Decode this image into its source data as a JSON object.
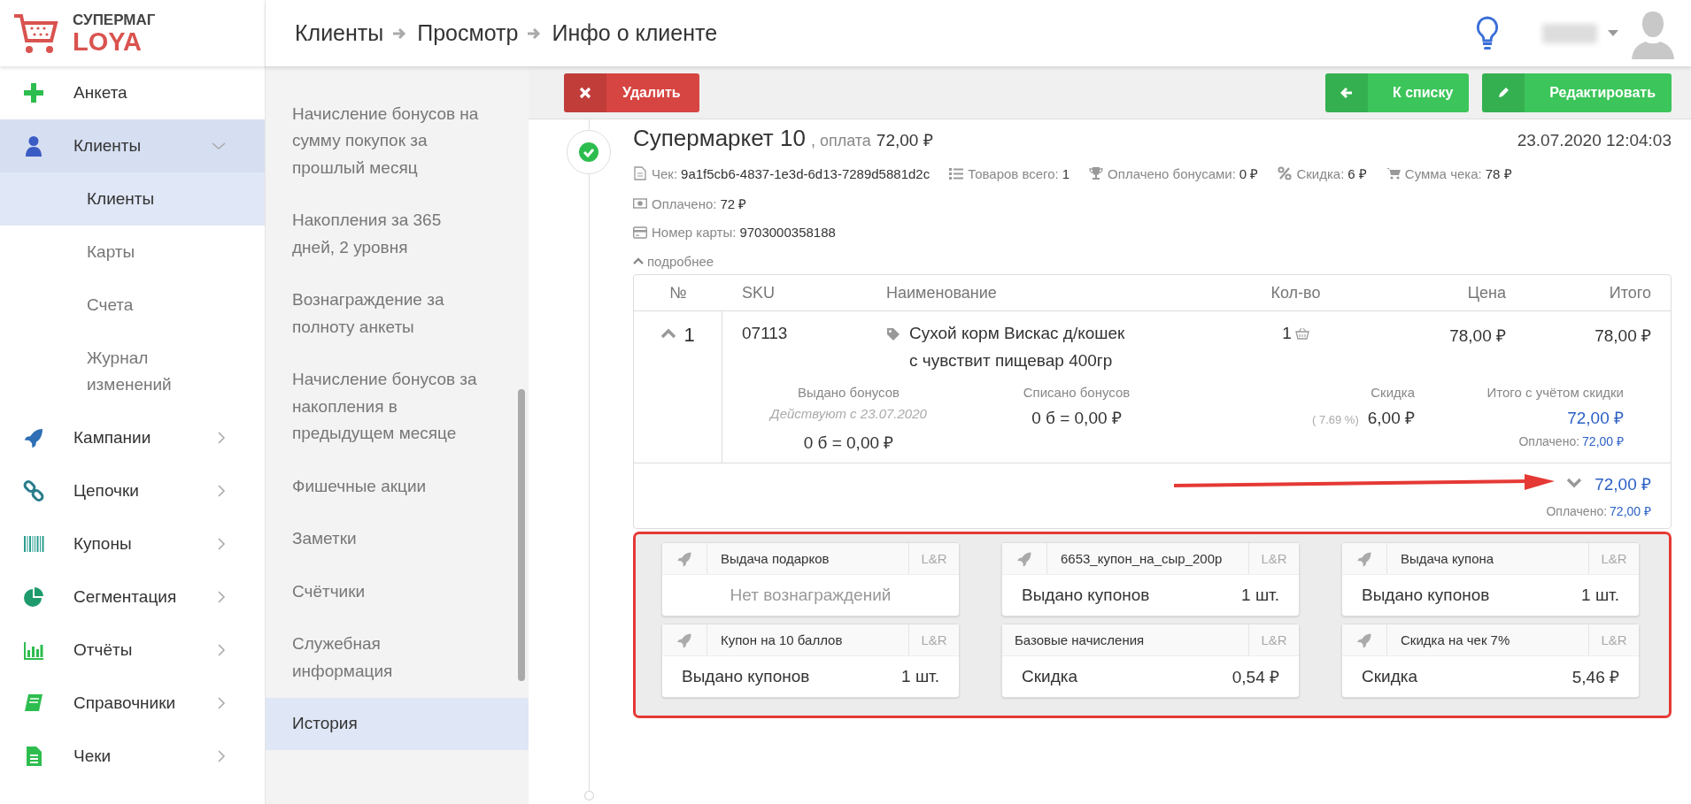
{
  "logo": {
    "top": "СУПЕРМАГ",
    "bottom": "LOYA"
  },
  "breadcrumb": [
    "Клиенты",
    "Просмотр",
    "Инфо о клиенте"
  ],
  "sidebar": {
    "items": [
      {
        "label": "Анкета",
        "selected": false
      },
      {
        "label": "Клиенты",
        "selected": true,
        "expanded": true,
        "children": [
          {
            "label": "Клиенты",
            "selected": true
          },
          {
            "label": "Карты",
            "selected": false
          },
          {
            "label": "Счета",
            "selected": false
          },
          {
            "label": "Журнал изменений",
            "selected": false
          }
        ]
      },
      {
        "label": "Кампании",
        "selected": false,
        "expanded": false
      },
      {
        "label": "Цепочки",
        "selected": false,
        "expanded": false
      },
      {
        "label": "Купоны",
        "selected": false,
        "expanded": false
      },
      {
        "label": "Сегментация",
        "selected": false,
        "expanded": false
      },
      {
        "label": "Отчёты",
        "selected": false,
        "expanded": false
      },
      {
        "label": "Справочники",
        "selected": false,
        "expanded": false
      },
      {
        "label": "Чеки",
        "selected": false,
        "expanded": false
      }
    ]
  },
  "submenu": {
    "items": [
      {
        "label": "Начисление бонусов на сумму покупок за прошлый месяц",
        "selected": false
      },
      {
        "label": "Накопления за 365 дней, 2 уровня",
        "selected": false
      },
      {
        "label": "Вознаграждение за полноту анкеты",
        "selected": false
      },
      {
        "label": "Начисление бонусов за накопления в предыдущем месяце",
        "selected": false
      },
      {
        "label": "Фишечные акции",
        "selected": false
      },
      {
        "label": "Заметки",
        "selected": false
      },
      {
        "label": "Счётчики",
        "selected": false
      },
      {
        "label": "Служебная информация",
        "selected": false
      },
      {
        "label": "История",
        "selected": true
      }
    ]
  },
  "toolbar": {
    "buttons": [
      {
        "label": "Удалить",
        "kind": "delete"
      },
      {
        "label": "К списку",
        "kind": "back"
      },
      {
        "label": "Редактировать",
        "kind": "edit"
      }
    ]
  },
  "receipt": {
    "store": "Супермаркет 10",
    "payment_label": ", оплата",
    "payment_amount": "72,00 ₽",
    "datetime": "23.07.2020 12:04:03",
    "info_rows": [
      [
        {
          "kind": "receipt",
          "label": "Чек:",
          "value": "9a1f5cb6-4837-1e3d-6d13-7289d5881d2c"
        },
        {
          "kind": "items",
          "label": "Товаров всего:",
          "value": "1"
        },
        {
          "kind": "bonus",
          "label": "Оплачено бонусами:",
          "value": "0 ₽"
        },
        {
          "kind": "discount",
          "label": "Скидка:",
          "value": "6 ₽"
        },
        {
          "kind": "sum",
          "label": "Сумма чека:",
          "value": "78 ₽"
        }
      ],
      [
        {
          "kind": "paid",
          "label": "Оплачено:",
          "value": "72 ₽"
        }
      ],
      [
        {
          "kind": "card",
          "label": "Номер карты:",
          "value": "9703000358188"
        }
      ]
    ],
    "details_toggle": {
      "label": "подробнее",
      "expanded": true
    },
    "table": {
      "columns": [
        "№",
        "SKU",
        "Наименование",
        "Кол-во",
        "Цена",
        "Итого"
      ],
      "rows": [
        {
          "number": "1",
          "expanded": true,
          "sku": "07113",
          "name": "Сухой корм Вискас д/кошек с чувствит пищевар 400гр",
          "qty": "1",
          "price": "78,00 ₽",
          "total": "78,00 ₽",
          "issued": {
            "label": "Выдано бонусов",
            "note": "Действуют с 23.07.2020",
            "value": "0 б = 0,00 ₽"
          },
          "written_off": {
            "label": "Списано бонусов",
            "value": "0 б = 0,00 ₽"
          },
          "discount": {
            "label": "Скидка",
            "percent": "( 7.69 %)",
            "value": "6,00 ₽"
          },
          "discounted_total": {
            "label": "Итого с учётом скидки",
            "value": "72,00 ₽",
            "paid_label": "Оплачено:",
            "paid_value": "72,00 ₽"
          }
        }
      ],
      "footer": {
        "expanded": false,
        "total": "72,00 ₽",
        "paid_label": "Оплачено:",
        "paid_value": "72,00 ₽"
      }
    },
    "campaigns": [
      {
        "has_icon": true,
        "title": "Выдача подарков",
        "tag": "L&R",
        "kind": "empty",
        "text": "Нет вознаграждений"
      },
      {
        "has_icon": true,
        "title": "6653_купон_на_сыр_200р",
        "tag": "L&R",
        "kind": "line",
        "label": "Выдано купонов",
        "value": "1 шт."
      },
      {
        "has_icon": true,
        "title": "Выдача купона",
        "tag": "L&R",
        "kind": "line",
        "label": "Выдано купонов",
        "value": "1 шт."
      },
      {
        "has_icon": true,
        "title": "Купон на 10 баллов",
        "tag": "L&R",
        "kind": "line",
        "label": "Выдано купонов",
        "value": "1 шт."
      },
      {
        "has_icon": false,
        "title": "Базовые начисления",
        "tag": "L&R",
        "kind": "line",
        "label": "Скидка",
        "value": "0,54 ₽"
      },
      {
        "has_icon": true,
        "title": "Скидка на чек 7%",
        "tag": "L&R",
        "kind": "line",
        "label": "Скидка",
        "value": "5,46 ₽"
      }
    ]
  }
}
